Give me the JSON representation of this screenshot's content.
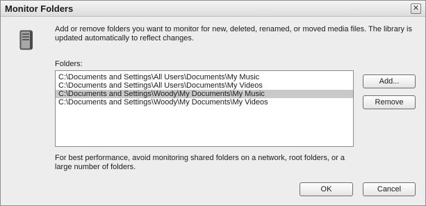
{
  "window": {
    "title": "Monitor Folders",
    "close_glyph": "✕"
  },
  "icon": "folder-library-icon",
  "description": "Add or remove folders you want to monitor for new, deleted, renamed, or moved media files. The library is updated automatically to reflect changes.",
  "folders": {
    "label": "Folders:",
    "items": [
      "C:\\Documents and Settings\\All Users\\Documents\\My Music",
      "C:\\Documents and Settings\\All Users\\Documents\\My Videos",
      "C:\\Documents and Settings\\Woody\\My Documents\\My Music",
      "C:\\Documents and Settings\\Woody\\My Documents\\My Videos"
    ],
    "selected_item": "C:\\Documents and Settings\\Woody\\My Documents\\My Music"
  },
  "buttons": {
    "add": "Add...",
    "remove": "Remove",
    "ok": "OK",
    "cancel": "Cancel"
  },
  "note": "For best performance, avoid monitoring shared folders on a network, root folders, or a large number of folders."
}
